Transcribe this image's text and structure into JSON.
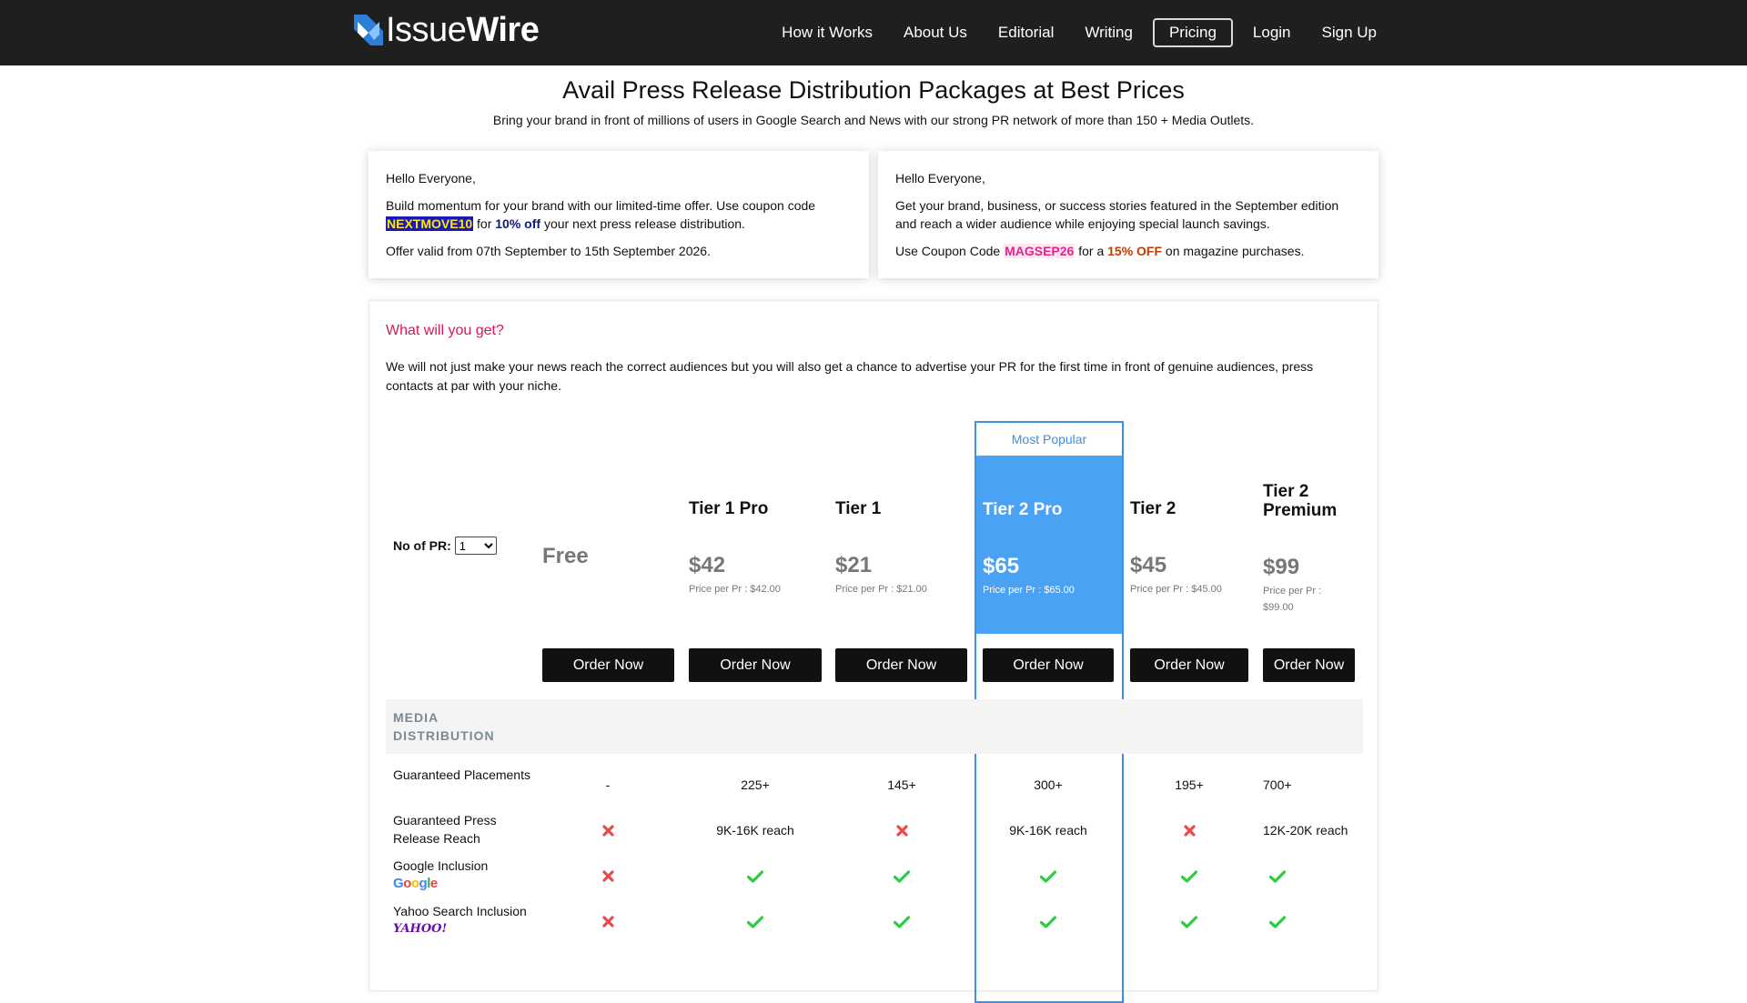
{
  "nav": {
    "logo_light": "Issue",
    "logo_bold": "Wire",
    "links": [
      "How it Works",
      "About Us",
      "Editorial",
      "Writing",
      "Pricing",
      "Login",
      "Sign Up"
    ],
    "active": "Pricing"
  },
  "header": {
    "title": "Avail Press Release Distribution Packages at Best Prices",
    "subtitle": "Bring your brand in front of millions of users in Google Search and News with our strong PR network of more than 150 + Media Outlets."
  },
  "offers": {
    "left": {
      "greeting": "Hello Everyone,",
      "line_a": "Build momentum for your brand with our limited-time offer. Use coupon code ",
      "code": "NEXTMOVE10",
      "line_b": " for ",
      "discount": "10% off",
      "line_c": " your next press release distribution.",
      "validity": "Offer valid from 07th September to 15th September 2026."
    },
    "right": {
      "greeting": "Hello Everyone,",
      "body": "Get your brand, business, or success stories featured in the September edition and reach a wider audience while enjoying special launch savings.",
      "line_a": "Use Coupon Code ",
      "code": "MAGSEP26",
      "line_b": " for a ",
      "discount": "15% OFF",
      "line_c": " on magazine purchases."
    }
  },
  "main": {
    "question": "What will you get?",
    "description": "We will not just make your news reach the correct audiences but you will also get a chance to advertise your PR for the first time in front of genuine audiences, press contacts at par with your niche.",
    "no_of_pr_label": "No of PR:",
    "no_of_pr_value": "1",
    "most_popular": "Most Popular",
    "order_label": "Order Now",
    "section_title": "MEDIA DISTRIBUTION",
    "accent_color": "#4aa2f5",
    "plans": [
      {
        "name": "Free",
        "price": "",
        "per_pr": ""
      },
      {
        "name": "Tier 1 Pro",
        "price": "$42",
        "per_pr": "Price per Pr : $42.00"
      },
      {
        "name": "Tier 1",
        "price": "$21",
        "per_pr": "Price per Pr : $21.00"
      },
      {
        "name": "Tier 2 Pro",
        "price": "$65",
        "per_pr": "Price per Pr : $65.00"
      },
      {
        "name": "Tier 2",
        "price": "$45",
        "per_pr": "Price per Pr : $45.00"
      },
      {
        "name": "Tier 2 Premium",
        "price": "$99",
        "per_pr": "Price per Pr : $99.00"
      }
    ],
    "rows": [
      {
        "label": "Guaranteed Placements",
        "values": [
          "-",
          "225+",
          "145+",
          "300+",
          "195+",
          "700+"
        ]
      },
      {
        "label": "Guaranteed Press Release Reach",
        "values": [
          "cross",
          "9K-16K reach",
          "cross",
          "9K-16K reach",
          "cross",
          "12K-20K reach"
        ]
      },
      {
        "label": "Google Inclusion",
        "logo": "Google",
        "values": [
          "cross",
          "check",
          "check",
          "check",
          "check",
          "check"
        ]
      },
      {
        "label": "Yahoo Search Inclusion",
        "logo": "YAHOO!",
        "values": [
          "cross",
          "check",
          "check",
          "check",
          "check",
          "check"
        ]
      }
    ]
  }
}
